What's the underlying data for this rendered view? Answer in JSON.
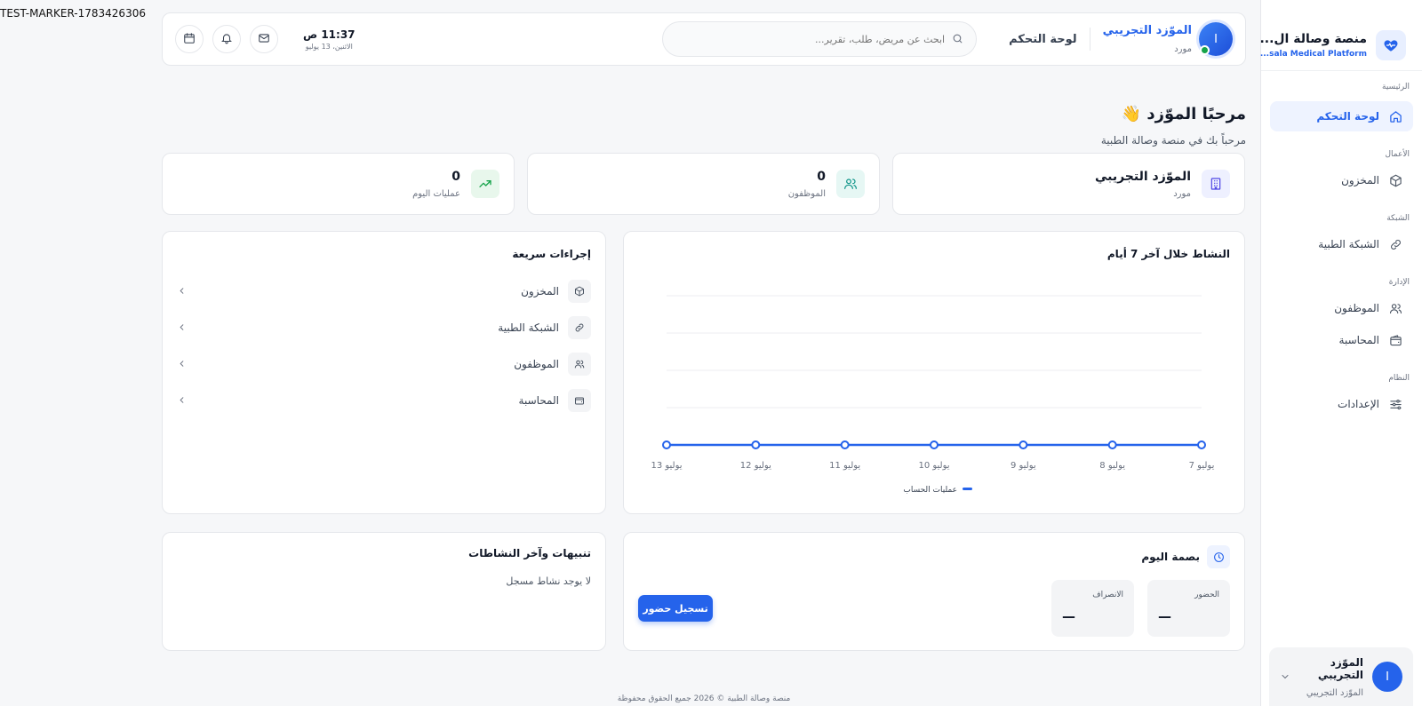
{
  "marker": "TEST-MARKER-1783426306",
  "brand": {
    "name": "منصة وصالة ال...",
    "subtitle": "...sala Medical Platform"
  },
  "sidebar": {
    "sections": [
      {
        "title": "الرئيسية",
        "items": [
          {
            "label": "لوحة التحكم",
            "icon": "home-icon",
            "active": true
          }
        ]
      },
      {
        "title": "الأعمال",
        "items": [
          {
            "label": "المخزون",
            "icon": "box-icon"
          }
        ]
      },
      {
        "title": "الشبكة",
        "items": [
          {
            "label": "الشبكة الطبية",
            "icon": "link-icon"
          }
        ]
      },
      {
        "title": "الإدارة",
        "items": [
          {
            "label": "الموظفون",
            "icon": "users-icon"
          },
          {
            "label": "المحاسبة",
            "icon": "wallet-icon"
          }
        ]
      },
      {
        "title": "النظام",
        "items": [
          {
            "label": "الإعدادات",
            "icon": "sliders-icon"
          }
        ]
      }
    ],
    "user": {
      "avatar": "I",
      "name": "الموّزد التجريبي",
      "role": "الموّزد التجريبي"
    }
  },
  "header": {
    "avatar": "I",
    "user_name": "الموّزد التجريبي",
    "user_role": "مورد",
    "page_title": "لوحة التحكم",
    "search_placeholder": "ابحث عن مريض، طلب، تقرير...",
    "time": "11:37 ص",
    "date": "الاثنين، 13 يوليو"
  },
  "welcome": {
    "title": "مرحبًا الموّزد 👋",
    "subtitle": "مرحباً بك في منصة وصالة الطبية"
  },
  "stats": [
    {
      "value": "الموّزد التجريبي",
      "label": "مورد",
      "icon": "building-icon",
      "color": "#4f46e5",
      "bg": "#eef0ff"
    },
    {
      "value": "0",
      "label": "الموظفون",
      "icon": "users-icon",
      "color": "#0d9488",
      "bg": "#e6f7f4"
    },
    {
      "value": "0",
      "label": "عمليات اليوم",
      "icon": "trending-up-icon",
      "color": "#16a34a",
      "bg": "#e8f7ec"
    }
  ],
  "activity": {
    "title": "النشاط خلال آخر 7 أيام",
    "chart_data": {
      "type": "line",
      "x": [
        "7 يوليو",
        "8 يوليو",
        "9 يوليو",
        "10 يوليو",
        "11 يوليو",
        "12 يوليو",
        "13 يوليو"
      ],
      "series": [
        {
          "name": "عمليات الحساب",
          "values": [
            0,
            0,
            0,
            0,
            0,
            0,
            0
          ]
        }
      ],
      "color": "#2563eb",
      "grid": true,
      "legend": "bottom"
    }
  },
  "quick_actions": {
    "title": "إجراءات سريعة",
    "items": [
      {
        "label": "المخزون",
        "icon": "box-icon"
      },
      {
        "label": "الشبكة الطبية",
        "icon": "link-icon"
      },
      {
        "label": "الموظفون",
        "icon": "users-icon"
      },
      {
        "label": "المحاسبة",
        "icon": "wallet-icon"
      }
    ]
  },
  "fingerprint": {
    "title": "بصمة اليوم",
    "checkin_label": "الحضور",
    "checkin_value": "—",
    "checkout_label": "الانصراف",
    "checkout_value": "—",
    "button": "تسجيل حضور"
  },
  "alerts": {
    "title": "تنبيهات وآخر النشاطات",
    "empty": "لا يوجد نشاط مسجل"
  },
  "footer": "منصة وصالة الطبية © 2026 جميع الحقوق محفوظة"
}
